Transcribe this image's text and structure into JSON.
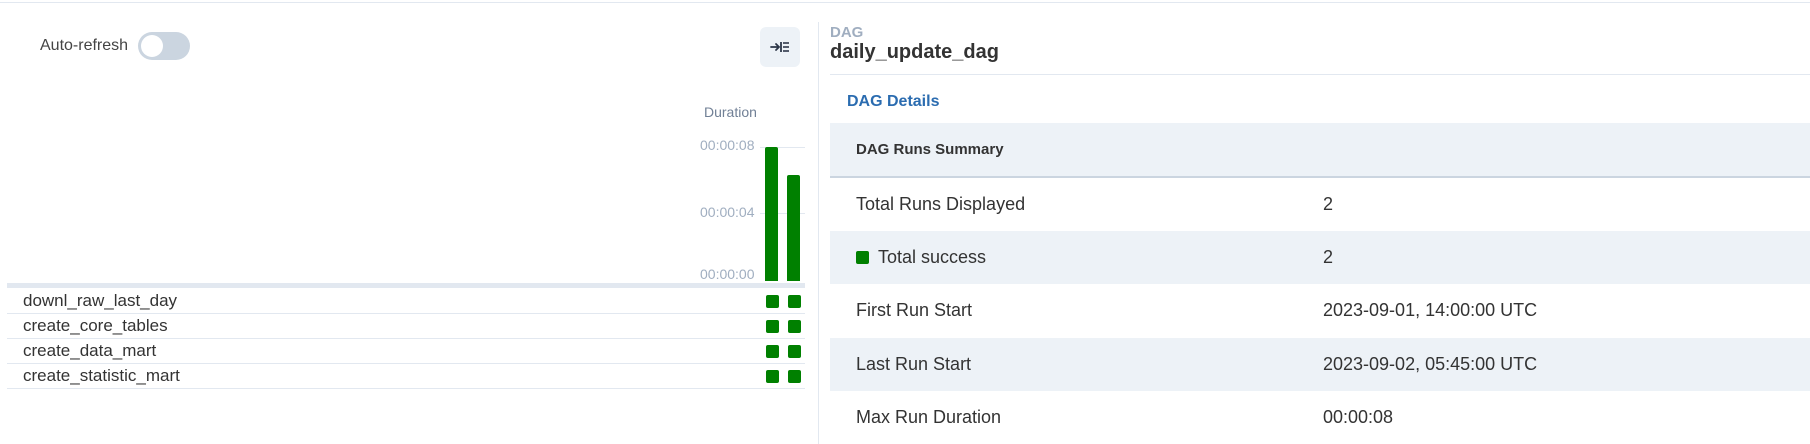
{
  "auto_refresh": {
    "label": "Auto-refresh",
    "enabled": false
  },
  "grid": {
    "duration_label": "Duration",
    "ticks": [
      "00:00:08",
      "00:00:04",
      "00:00:00"
    ],
    "runs": [
      {
        "duration_seconds": 8,
        "state": "success"
      },
      {
        "duration_seconds": 6.3,
        "state": "success"
      }
    ],
    "tasks": [
      {
        "name": "downl_raw_last_day",
        "states": [
          "success",
          "success"
        ]
      },
      {
        "name": "create_core_tables",
        "states": [
          "success",
          "success"
        ]
      },
      {
        "name": "create_data_mart",
        "states": [
          "success",
          "success"
        ]
      },
      {
        "name": "create_statistic_mart",
        "states": [
          "success",
          "success"
        ]
      }
    ],
    "success_color": "#008000"
  },
  "details": {
    "kicker": "DAG",
    "dag_id": "daily_update_dag",
    "details_link": "DAG Details",
    "summary_title": "DAG Runs Summary",
    "rows": [
      {
        "key": "Total Runs Displayed",
        "value": "2"
      },
      {
        "key": "Total success",
        "value": "2",
        "marker_color": "#008000"
      },
      {
        "key": "First Run Start",
        "value": "2023-09-01, 14:00:00 UTC"
      },
      {
        "key": "Last Run Start",
        "value": "2023-09-02, 05:45:00 UTC"
      },
      {
        "key": "Max Run Duration",
        "value": "00:00:08"
      }
    ]
  },
  "icons": {
    "collapse": "collapse-panel-icon"
  }
}
